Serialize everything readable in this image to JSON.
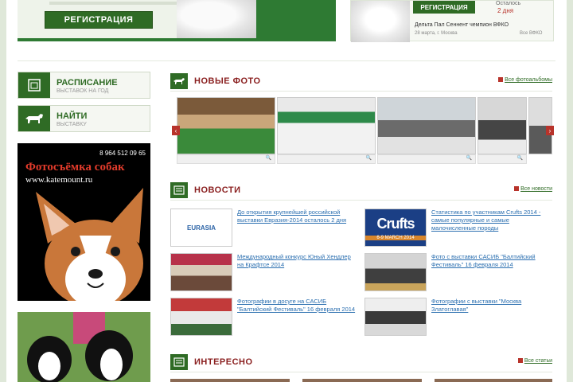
{
  "banner_left": {
    "register_label": "РЕГИСТРАЦИЯ"
  },
  "banner_right": {
    "register_label": "РЕГИСТРАЦИЯ",
    "status": "Осталось",
    "days": "2 дня",
    "title": "Дельта Пал Сеннент чемпион ВФКО",
    "date": "28 марта, г. Москва",
    "all": "Все ВФКО"
  },
  "sidebar": {
    "schedule": {
      "title": "РАСПИСАНИЕ",
      "sub": "ВЫСТАВОК НА ГОД",
      "icon": "calendar-icon"
    },
    "find": {
      "title": "НАЙТИ",
      "sub": "ВЫСТАВКУ",
      "icon": "dog-icon"
    }
  },
  "ad": {
    "phone": "8 964 512 09 65",
    "headline": "Фотосъёмка собак",
    "url": "www.katemount.ru"
  },
  "photos_section": {
    "title": "НОВЫЕ ФОТО",
    "all_link": "Все фотоальбомы"
  },
  "news_section": {
    "title": "НОВОСТИ",
    "all_link": "Все новости"
  },
  "interesting_section": {
    "title": "ИНТЕРЕСНО",
    "all_link": "Все статьи"
  },
  "news": [
    {
      "text": "До открытия крупнейшей российской выставки Евразия-2014 осталось 2 дня",
      "thumb_label": "EURASIA"
    },
    {
      "text": "Статистика по участникам Crufts 2014 - самые популярные и самые малочисленные породы",
      "thumb_label": "Crufts",
      "thumb_sub": "6-9 MARCH 2014"
    },
    {
      "text": "Международный конкурс Юный Хендлер на Крафтсе 2014",
      "thumb_label": ""
    },
    {
      "text": "Фото с выставки САСИБ \"Балтийский Фестиваль\" 16 февраля 2014",
      "thumb_label": ""
    },
    {
      "text": "Фотографии в досуге на САСИБ \"Балтийский Фестиваль\" 16 февраля 2014",
      "thumb_label": ""
    },
    {
      "text": "Фотографии с выставки \"Москва Златоглавая\"",
      "thumb_label": ""
    }
  ]
}
